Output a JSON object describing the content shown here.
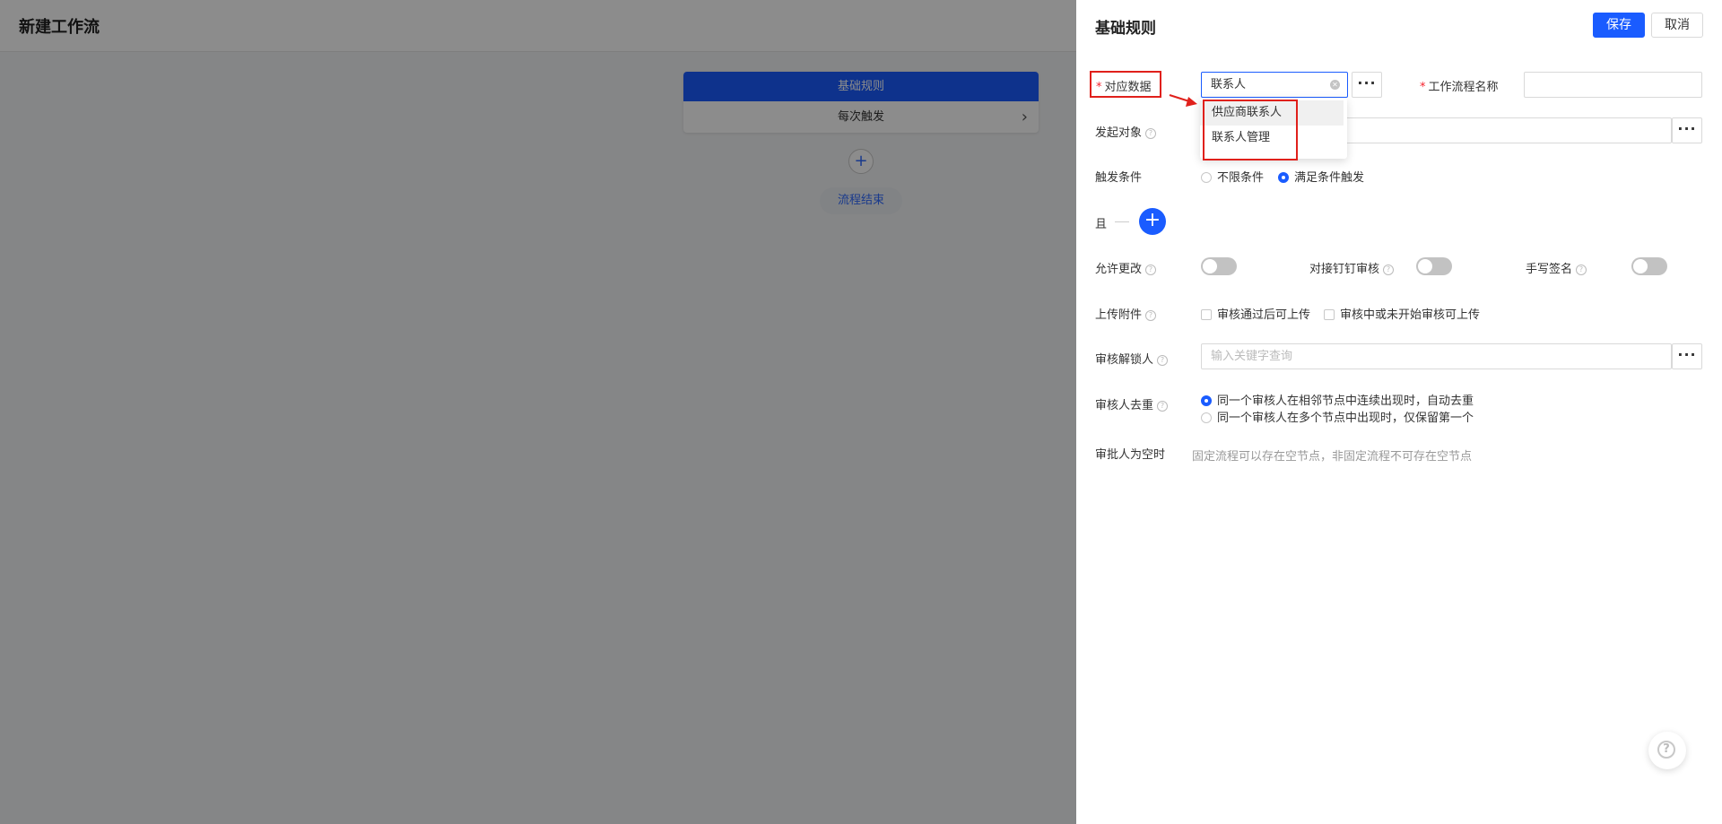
{
  "page": {
    "title": "新建工作流"
  },
  "flow": {
    "card_title": "基础规则",
    "card_item": "每次触发",
    "add_symbol": "+",
    "end_label": "流程结束"
  },
  "drawer": {
    "title": "基础规则",
    "save_label": "保存",
    "cancel_label": "取消",
    "fields": {
      "data": {
        "required_mark": "*",
        "label": "对应数据",
        "value": "联系人",
        "more": "···"
      },
      "workflow_name": {
        "required_mark": "*",
        "label": "工作流程名称",
        "value": ""
      },
      "initiator": {
        "label": "发起对象",
        "value": "",
        "more": "···"
      },
      "trigger": {
        "label": "触发条件",
        "options": [
          "不限条件",
          "满足条件触发"
        ],
        "selected": "满足条件触发"
      },
      "and": {
        "label": "且",
        "add_symbol": "+"
      },
      "allow_edit": {
        "label": "允许更改",
        "on": false
      },
      "dingtalk": {
        "label": "对接钉钉审核",
        "on": false
      },
      "signature": {
        "label": "手写签名",
        "on": false
      },
      "attachment": {
        "label": "上传附件",
        "options": [
          "审核通过后可上传",
          "审核中或未开始审核可上传"
        ],
        "checked": [
          false,
          false
        ]
      },
      "unlocker": {
        "label": "审核解锁人",
        "placeholder": "输入关键字查询",
        "more": "···"
      },
      "dedupe": {
        "label": "审核人去重",
        "options": [
          "同一个审核人在相邻节点中连续出现时，自动去重",
          "同一个审核人在多个节点中出现时，仅保留第一个"
        ],
        "selected": "同一个审核人在相邻节点中连续出现时，自动去重"
      },
      "empty_approver": {
        "label": "审批人为空时",
        "hint": "固定流程可以存在空节点，非固定流程不可存在空节点"
      }
    },
    "dropdown": {
      "items": [
        "供应商联系人",
        "联系人管理"
      ],
      "highlighted": "供应商联系人"
    },
    "help_button": "?"
  },
  "colors": {
    "primary": "#1a5cff",
    "annotation": "#e0201b",
    "required": "#f5222d"
  },
  "icons": [
    "chevron-right-icon",
    "plus-icon",
    "clear-icon",
    "more-icon",
    "help-icon",
    "arrow-icon"
  ]
}
